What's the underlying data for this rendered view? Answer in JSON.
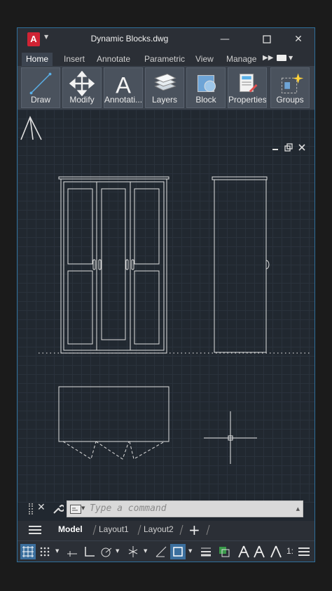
{
  "window": {
    "title": "Dynamic Blocks.dwg",
    "app_logo": "A"
  },
  "tabs": [
    {
      "label": "Home"
    },
    {
      "label": "Insert"
    },
    {
      "label": "Annotate"
    },
    {
      "label": "Parametric"
    },
    {
      "label": "View"
    },
    {
      "label": "Manage"
    }
  ],
  "ribbon": [
    {
      "label": "Draw",
      "icon": "line-icon"
    },
    {
      "label": "Modify",
      "icon": "move-arrows-icon"
    },
    {
      "label": "Annotati...",
      "icon": "text-a-icon"
    },
    {
      "label": "Layers",
      "icon": "layers-stack-icon"
    },
    {
      "label": "Block",
      "icon": "block-insert-icon"
    },
    {
      "label": "Properties",
      "icon": "properties-palette-icon"
    },
    {
      "label": "Groups",
      "icon": "group-sparkle-icon"
    }
  ],
  "command": {
    "placeholder": "Type a command"
  },
  "layout_tabs": [
    {
      "label": "Model"
    },
    {
      "label": "Layout1"
    },
    {
      "label": "Layout2"
    }
  ],
  "status": {
    "scale": "1:"
  },
  "colors": {
    "accent": "#2f6f9a",
    "canvas": "#212830",
    "linework": "#e0e0e0"
  }
}
